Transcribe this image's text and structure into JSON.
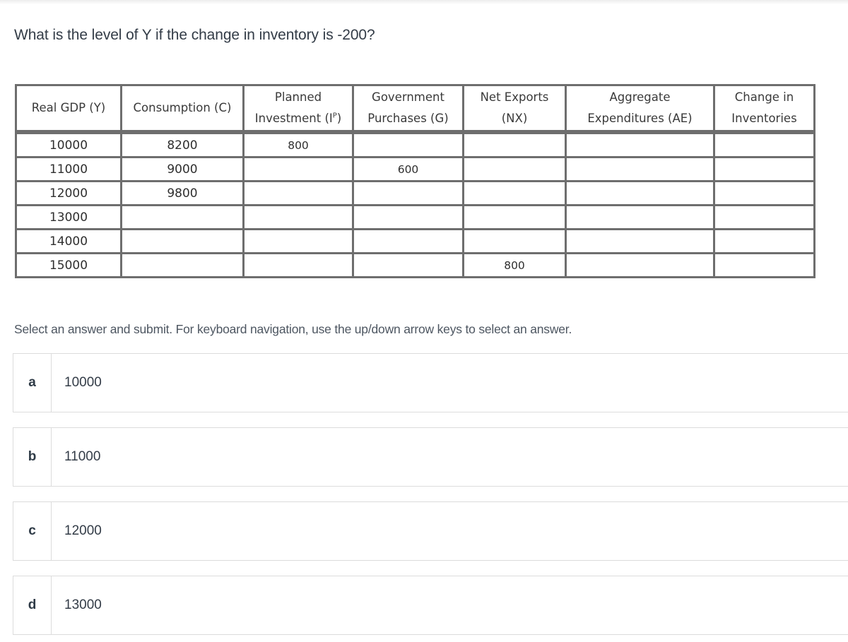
{
  "question": {
    "text": "What is the level of Y if the change in inventory is -200?"
  },
  "table": {
    "headers": [
      {
        "line1": "Real GDP (Y)",
        "line2": ""
      },
      {
        "line1": "Consumption (C)",
        "line2": ""
      },
      {
        "line1": "Planned",
        "line2": "Investment (I",
        "sup": "P",
        "line2_end": ")"
      },
      {
        "line1": "Government",
        "line2": "Purchases (G)"
      },
      {
        "line1": "Net Exports",
        "line2": "(NX)"
      },
      {
        "line1": "Aggregate",
        "line2": "Expenditures (AE)"
      },
      {
        "line1": "Change in",
        "line2": "Inventories"
      }
    ],
    "rows": [
      {
        "y": "10000",
        "c": "8200",
        "ip": "800",
        "g": "",
        "nx": "",
        "ae": "",
        "inv": ""
      },
      {
        "y": "11000",
        "c": "9000",
        "ip": "",
        "g": "600",
        "nx": "",
        "ae": "",
        "inv": ""
      },
      {
        "y": "12000",
        "c": "9800",
        "ip": "",
        "g": "",
        "nx": "",
        "ae": "",
        "inv": ""
      },
      {
        "y": "13000",
        "c": "",
        "ip": "",
        "g": "",
        "nx": "",
        "ae": "",
        "inv": ""
      },
      {
        "y": "14000",
        "c": "",
        "ip": "",
        "g": "",
        "nx": "",
        "ae": "",
        "inv": ""
      },
      {
        "y": "15000",
        "c": "",
        "ip": "",
        "g": "",
        "nx": "800",
        "ae": "",
        "inv": ""
      }
    ]
  },
  "instructions": "Select an answer and submit. For keyboard navigation, use the up/down arrow keys to select an answer.",
  "options": [
    {
      "letter": "a",
      "value": "10000"
    },
    {
      "letter": "b",
      "value": "11000"
    },
    {
      "letter": "c",
      "value": "12000"
    },
    {
      "letter": "d",
      "value": "13000"
    }
  ]
}
